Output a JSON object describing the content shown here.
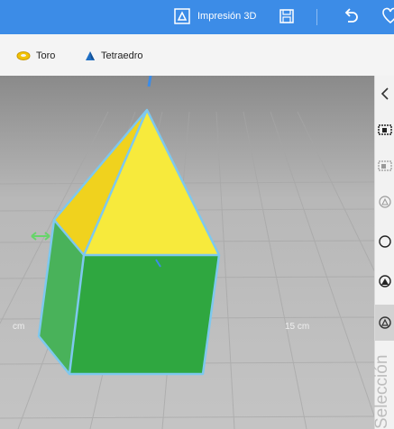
{
  "titlebar": {
    "print3d_label": "Impresión 3D",
    "accent": "#3c8ce7"
  },
  "shapes": {
    "items": [
      {
        "label": "Toro",
        "icon": "torus-icon"
      },
      {
        "label": "Tetraedro",
        "icon": "tetrahedron-icon"
      }
    ]
  },
  "viewport": {
    "ruler_left": "cm",
    "ruler_right": "15 cm"
  },
  "sidepanel": {
    "title": "Selección",
    "icons": [
      "chevron-left-icon",
      "select-icon",
      "extrude-icon",
      "group-icon",
      "ungroup-icon",
      "magic-select-icon",
      "shapes-icon"
    ]
  },
  "colors": {
    "floor": "#bdbdbd",
    "grid_dark": "#b0b0b0",
    "prism_green": "#33ad45",
    "pyramid_yellow": "#f5e63a",
    "selection_outline": "#7ec8ee"
  }
}
